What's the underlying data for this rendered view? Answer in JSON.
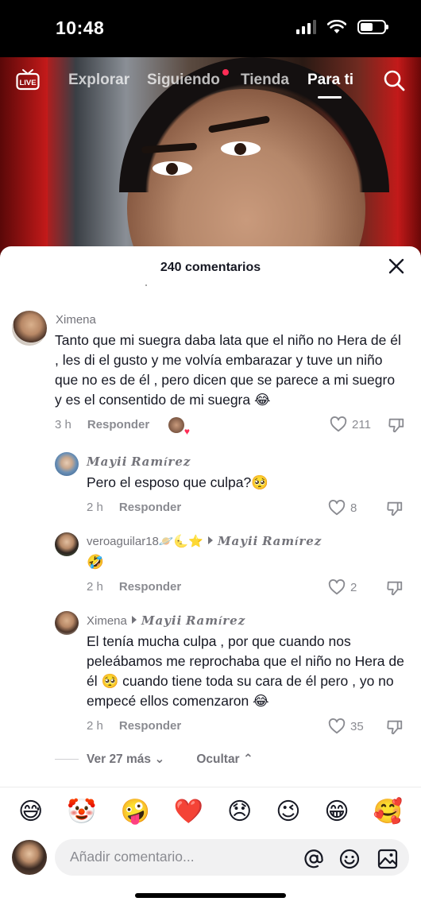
{
  "status_bar": {
    "time": "10:48"
  },
  "top_nav": {
    "tabs": [
      {
        "label": "Explorar"
      },
      {
        "label": "Siguiendo"
      },
      {
        "label": "Tienda"
      },
      {
        "label": "Para ti"
      }
    ],
    "active_tab": "Para ti"
  },
  "comments_panel": {
    "title": "240 comentarios",
    "comments": [
      {
        "username": "Ximena",
        "text": "Tanto que mi suegra daba lata que el niño no Hera de él , les di el gusto y me volvía embarazar y tuve un niño que no es de él , pero dicen que se parece a mi suegro y es el consentido de mi suegra 😂",
        "time": "3 h",
        "reply_label": "Responder",
        "likes": "211"
      },
      {
        "username": "𝑴𝒂𝒚𝒊𝒊 𝑹𝒂𝒎í𝒓𝒆𝒛",
        "text": "Pero el esposo que culpa?🥺",
        "time": "2 h",
        "reply_label": "Responder",
        "likes": "8"
      },
      {
        "username": "veroaguilar18🪐🌜⭐",
        "reply_to": "𝑴𝒂𝒚𝒊𝒊 𝑹𝒂𝒎í𝒓𝒆𝒛",
        "text": "🤣",
        "time": "2 h",
        "reply_label": "Responder",
        "likes": "2"
      },
      {
        "username": "Ximena",
        "reply_to": "𝑴𝒂𝒚𝒊𝒊 𝑹𝒂𝒎í𝒓𝒆𝒛",
        "text": "El tenía mucha culpa , por que cuando nos peleábamos me reprochaba que el niño no Hera de él 🥺 cuando tiene toda su cara de él pero , yo no empecé ellos comenzaron 😂",
        "time": "2 h",
        "reply_label": "Responder",
        "likes": "35"
      }
    ],
    "view_more": "Ver 27 más",
    "hide": "Ocultar"
  },
  "emoji_bar": [
    "😅",
    "🤡",
    "🤪",
    "❤️",
    "😞",
    "😉",
    "😁",
    "🥰"
  ],
  "comment_input": {
    "placeholder": "Añadir comentario..."
  }
}
